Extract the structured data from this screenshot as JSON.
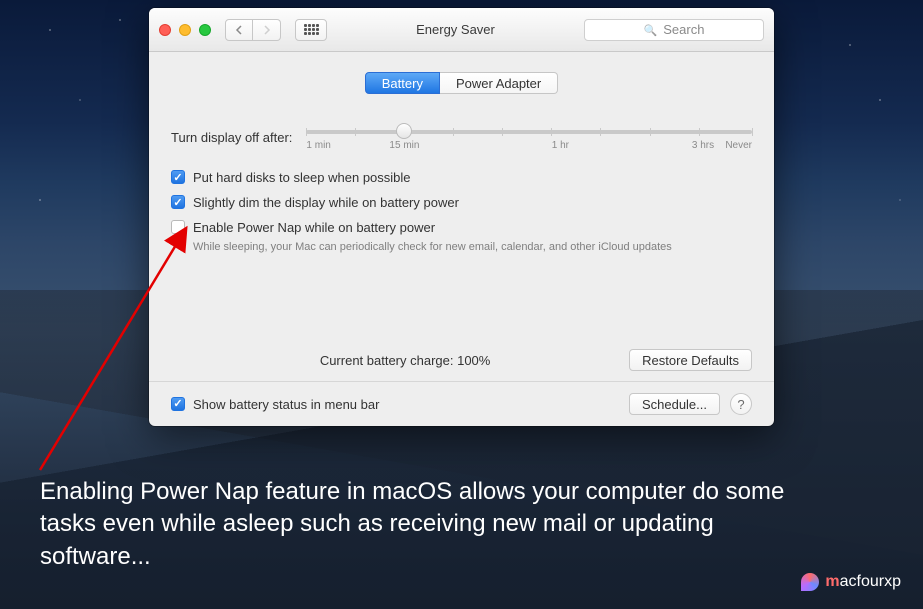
{
  "window": {
    "title": "Energy Saver",
    "search_placeholder": "Search"
  },
  "tabs": {
    "battery": "Battery",
    "power_adapter": "Power Adapter",
    "active": "battery"
  },
  "slider": {
    "label": "Turn display off after:",
    "ticks": [
      "1 min",
      "15 min",
      "1 hr",
      "3 hrs",
      "Never"
    ],
    "value_percent": 22
  },
  "options": {
    "hard_disk": {
      "checked": true,
      "label": "Put hard disks to sleep when possible"
    },
    "dim": {
      "checked": true,
      "label": "Slightly dim the display while on battery power"
    },
    "power_nap": {
      "checked": false,
      "label": "Enable Power Nap while on battery power",
      "sub": "While sleeping, your Mac can periodically check for new email, calendar, and other iCloud updates"
    }
  },
  "status": {
    "charge": "Current battery charge: 100%",
    "restore_defaults": "Restore Defaults"
  },
  "footer": {
    "menu_bar": {
      "checked": true,
      "label": "Show battery status in menu bar"
    },
    "schedule": "Schedule...",
    "help": "?"
  },
  "caption": "Enabling Power Nap feature in macOS allows your computer do some tasks even while asleep such as receiving new mail or updating software...",
  "watermark": {
    "brand_html_prefix": "m",
    "brand_html_rest": "acfourxp"
  }
}
